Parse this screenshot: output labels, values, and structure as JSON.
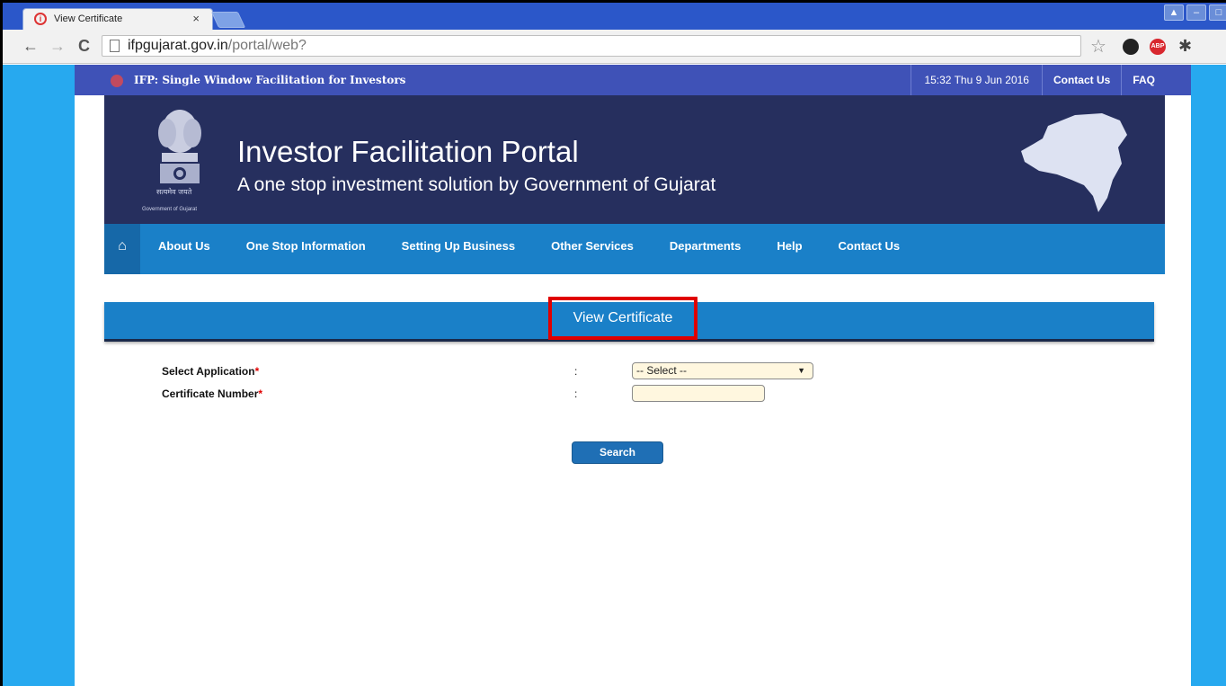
{
  "browser": {
    "tab_title": "View Certificate",
    "tab_close": "×",
    "url_domain": "ifpgujarat.gov.in",
    "url_path": "/portal/web?",
    "back_icon": "←",
    "forward_icon": "→",
    "reload_icon": "C",
    "star_icon": "☆",
    "adblock_label": "ABP",
    "window_buttons": [
      "▲",
      "–",
      "□"
    ]
  },
  "infobar": {
    "title": "IFP: Single Window Facilitation for Investors",
    "datetime": "15:32  Thu  9 Jun 2016",
    "contact": "Contact Us",
    "faq": "FAQ"
  },
  "header": {
    "title": "Investor Facilitation Portal",
    "subtitle": "A one stop investment solution by Government of Gujarat",
    "emblem_caption": "Government of Gujarat",
    "emblem_motto": "सत्यमेव जयते"
  },
  "nav": {
    "home_icon": "⌂",
    "items": [
      "About Us",
      "One Stop Information",
      "Setting Up Business",
      "Other Services",
      "Departments",
      "Help",
      "Contact Us"
    ]
  },
  "section": {
    "title": "View Certificate"
  },
  "form": {
    "select_application_label": "Select Application",
    "certificate_number_label": "Certificate Number",
    "required_mark": "*",
    "colon": ":",
    "select_value": "-- Select --",
    "select_arrow": "▼",
    "certificate_number_value": "",
    "search_label": "Search"
  },
  "colors": {
    "side_blue": "#27a9ef",
    "infobar": "#3f52b7",
    "banner": "#262f5e",
    "nav": "#1a80c8",
    "highlight": "#e00000"
  }
}
